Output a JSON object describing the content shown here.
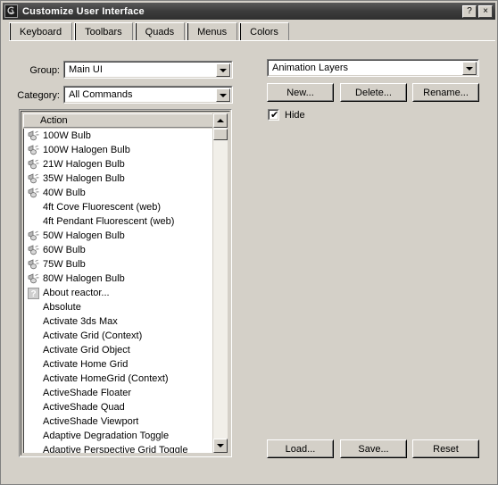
{
  "window": {
    "title": "Customize User Interface",
    "icon": "max-logo-icon",
    "help_button": "?",
    "close_button": "×"
  },
  "tabs": [
    {
      "label": "Keyboard",
      "selected": true
    },
    {
      "label": "Toolbars",
      "selected": false
    },
    {
      "label": "Quads",
      "selected": false
    },
    {
      "label": "Menus",
      "selected": false
    },
    {
      "label": "Colors",
      "selected": false
    }
  ],
  "left_panel": {
    "group_label": "Group:",
    "group_value": "Main UI",
    "category_label": "Category:",
    "category_value": "All Commands",
    "list_header": "Action",
    "items": [
      {
        "label": "100W Bulb",
        "icon": "bulb-icon"
      },
      {
        "label": "100W Halogen Bulb",
        "icon": "bulb-icon"
      },
      {
        "label": "21W Halogen Bulb",
        "icon": "bulb-icon"
      },
      {
        "label": "35W Halogen Bulb",
        "icon": "bulb-icon"
      },
      {
        "label": "40W Bulb",
        "icon": "bulb-icon"
      },
      {
        "label": "4ft Cove Fluorescent (web)",
        "icon": "none"
      },
      {
        "label": "4ft Pendant Fluorescent (web)",
        "icon": "none"
      },
      {
        "label": "50W Halogen Bulb",
        "icon": "bulb-icon"
      },
      {
        "label": "60W Bulb",
        "icon": "bulb-icon"
      },
      {
        "label": "75W Bulb",
        "icon": "bulb-icon"
      },
      {
        "label": "80W Halogen Bulb",
        "icon": "bulb-icon"
      },
      {
        "label": "About reactor...",
        "icon": "question-icon"
      },
      {
        "label": "Absolute",
        "icon": "none"
      },
      {
        "label": "Activate 3ds Max",
        "icon": "none"
      },
      {
        "label": "Activate Grid (Context)",
        "icon": "none"
      },
      {
        "label": "Activate Grid Object",
        "icon": "none"
      },
      {
        "label": "Activate Home Grid",
        "icon": "none"
      },
      {
        "label": "Activate HomeGrid (Context)",
        "icon": "none"
      },
      {
        "label": "ActiveShade Floater",
        "icon": "none"
      },
      {
        "label": "ActiveShade Quad",
        "icon": "none"
      },
      {
        "label": "ActiveShade Viewport",
        "icon": "none"
      },
      {
        "label": "Adaptive Degradation Toggle",
        "icon": "none"
      },
      {
        "label": "Adaptive Perspective Grid Toggle",
        "icon": "none"
      }
    ]
  },
  "right_panel": {
    "set_value": "Animation Layers",
    "new_label": "New...",
    "delete_label": "Delete...",
    "rename_label": "Rename...",
    "hide_label": "Hide",
    "hide_checked": true,
    "checkmark": "✔"
  },
  "footer": {
    "load_label": "Load...",
    "save_label": "Save...",
    "reset_label": "Reset"
  },
  "colors": {
    "window_face": "#d4d0c8",
    "titlebar": "#3c3c3c",
    "list_background": "#ffffff",
    "text": "#000000"
  }
}
